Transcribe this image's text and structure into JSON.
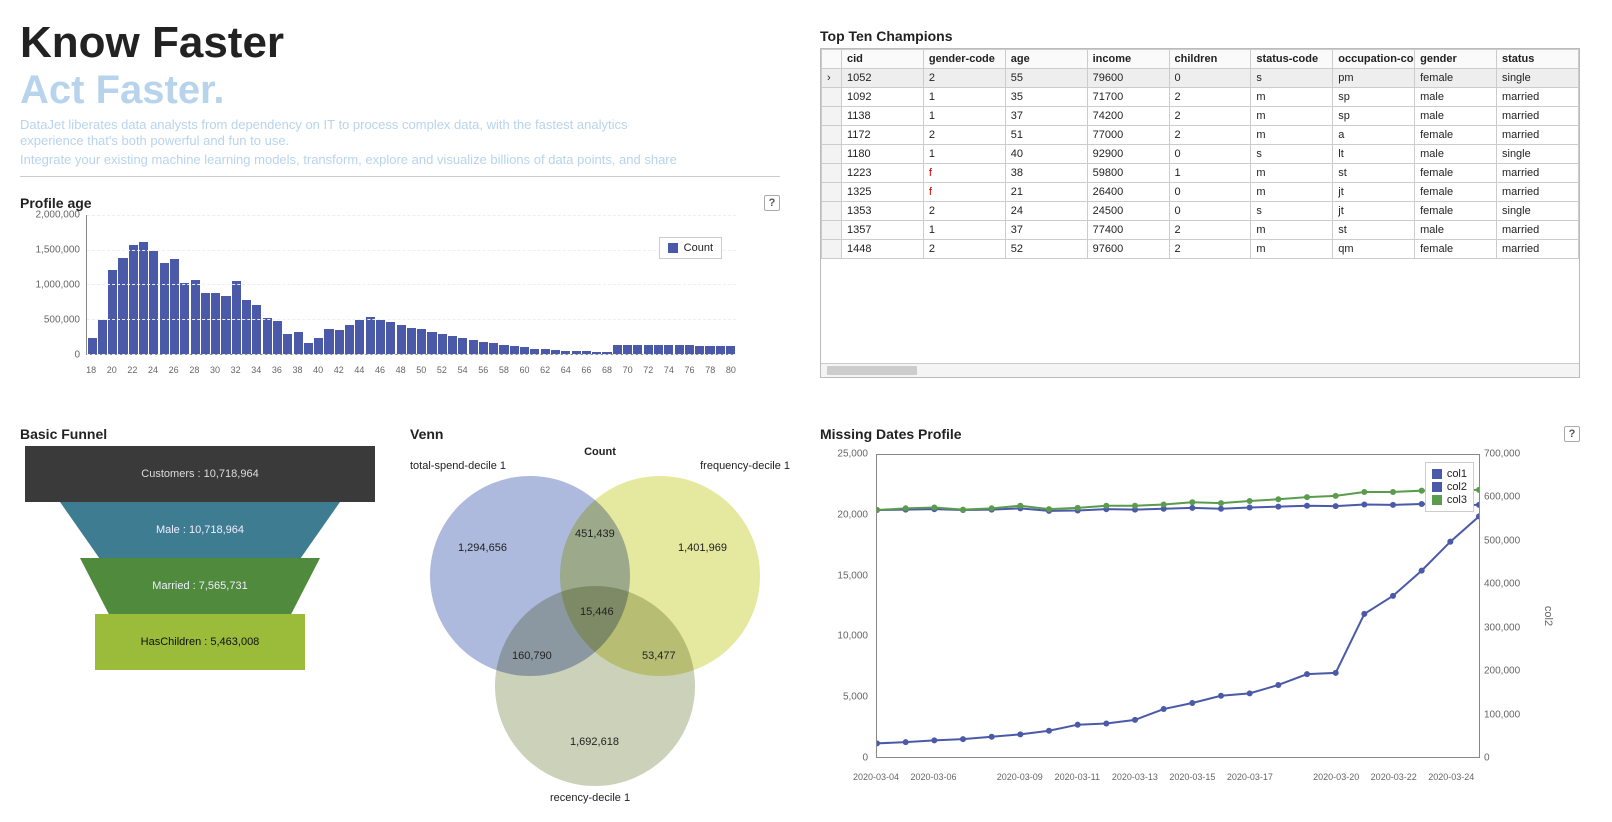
{
  "hero": {
    "title": "Know Faster",
    "subtitle": "Act Faster.",
    "p1": "DataJet liberates data analysts from dependency on IT to process complex data, with the fastest analytics experience that's both powerful and fun to use.",
    "p2": "Integrate your existing machine learning models, transform, explore and visualize billions of data points, and share"
  },
  "profile_age": {
    "title": "Profile age",
    "legend": "Count",
    "help": "?"
  },
  "funnel": {
    "title": "Basic Funnel",
    "stages": [
      "Customers : 10,718,964",
      "Male : 10,718,964",
      "Married : 7,565,731",
      "HasChildren : 5,463,008"
    ]
  },
  "venn": {
    "title": "Venn",
    "center_title": "Count",
    "labels": {
      "a": "total-spend-decile 1",
      "b": "frequency-decile 1",
      "c": "recency-decile 1",
      "only_a": "1,294,656",
      "only_b": "1,401,969",
      "only_c": "1,692,618",
      "ab": "451,439",
      "ac": "160,790",
      "bc": "53,477",
      "abc": "15,446"
    }
  },
  "table": {
    "title": "Top Ten Champions",
    "headers": [
      "cid",
      "gender-code",
      "age",
      "income",
      "children",
      "status-code",
      "occupation-cod",
      "gender",
      "status"
    ],
    "rows": [
      [
        "1052",
        "2",
        "55",
        "79600",
        "0",
        "s",
        "pm",
        "female",
        "single"
      ],
      [
        "1092",
        "1",
        "35",
        "71700",
        "2",
        "m",
        "sp",
        "male",
        "married"
      ],
      [
        "1138",
        "1",
        "37",
        "74200",
        "2",
        "m",
        "sp",
        "male",
        "married"
      ],
      [
        "1172",
        "2",
        "51",
        "77000",
        "2",
        "m",
        "a",
        "female",
        "married"
      ],
      [
        "1180",
        "1",
        "40",
        "92900",
        "0",
        "s",
        "lt",
        "male",
        "single"
      ],
      [
        "1223",
        "f",
        "38",
        "59800",
        "1",
        "m",
        "st",
        "female",
        "married"
      ],
      [
        "1325",
        "f",
        "21",
        "26400",
        "0",
        "m",
        "jt",
        "female",
        "married"
      ],
      [
        "1353",
        "2",
        "24",
        "24500",
        "0",
        "s",
        "jt",
        "female",
        "single"
      ],
      [
        "1357",
        "1",
        "37",
        "77400",
        "2",
        "m",
        "st",
        "male",
        "married"
      ],
      [
        "1448",
        "2",
        "52",
        "97600",
        "2",
        "m",
        "qm",
        "female",
        "married"
      ]
    ]
  },
  "missing": {
    "title": "Missing Dates Profile",
    "help": "?",
    "legend": [
      "col1",
      "col2",
      "col3"
    ],
    "axis_r_title": "col2"
  },
  "chart_data": [
    {
      "id": "profile_age",
      "type": "bar",
      "title": "Profile age",
      "ylabel": "",
      "ylim": [
        0,
        2000000
      ],
      "yticks": [
        0,
        500000,
        1000000,
        1500000,
        2000000
      ],
      "ytick_labels": [
        "0",
        "500,000",
        "1,000,000",
        "1,500,000",
        "2,000,000"
      ],
      "xticks": [
        18,
        20,
        22,
        24,
        26,
        28,
        30,
        32,
        34,
        36,
        38,
        40,
        42,
        44,
        46,
        48,
        50,
        52,
        54,
        56,
        58,
        60,
        62,
        64,
        66,
        68,
        70,
        72,
        74,
        76,
        78,
        80
      ],
      "series": [
        {
          "name": "Count",
          "x": [
            18,
            19,
            20,
            21,
            22,
            23,
            24,
            25,
            26,
            27,
            28,
            29,
            30,
            31,
            32,
            33,
            34,
            35,
            36,
            37,
            38,
            39,
            40,
            41,
            42,
            43,
            44,
            45,
            46,
            47,
            48,
            49,
            50,
            51,
            52,
            53,
            54,
            55,
            56,
            57,
            58,
            59,
            60,
            61,
            62,
            63,
            64,
            65,
            66,
            67,
            68,
            69,
            70,
            71,
            72,
            73,
            74,
            75,
            76,
            77,
            78,
            79,
            80
          ],
          "values": [
            230000,
            480000,
            1200000,
            1380000,
            1570000,
            1610000,
            1480000,
            1310000,
            1370000,
            1020000,
            1060000,
            870000,
            880000,
            830000,
            1050000,
            770000,
            700000,
            510000,
            470000,
            290000,
            310000,
            160000,
            230000,
            360000,
            340000,
            410000,
            480000,
            530000,
            480000,
            450000,
            410000,
            370000,
            350000,
            320000,
            280000,
            250000,
            220000,
            200000,
            170000,
            150000,
            130000,
            110000,
            95000,
            75000,
            65000,
            55000,
            45000,
            40000,
            35000,
            32000,
            30000,
            130000,
            130000,
            130000,
            130000,
            128000,
            125000,
            122000,
            120000,
            118000,
            116000,
            114000,
            112000
          ]
        }
      ]
    },
    {
      "id": "basic_funnel",
      "type": "funnel",
      "title": "Basic Funnel",
      "categories": [
        "Customers",
        "Male",
        "Married",
        "HasChildren"
      ],
      "values": [
        10718964,
        10718964,
        7565731,
        5463008
      ]
    },
    {
      "id": "venn",
      "type": "venn",
      "title": "Count",
      "sets": {
        "total-spend-decile 1": 1294656,
        "frequency-decile 1": 1401969,
        "recency-decile 1": 1692618,
        "total-spend-decile 1 & frequency-decile 1": 451439,
        "total-spend-decile 1 & recency-decile 1": 160790,
        "frequency-decile 1 & recency-decile 1": 53477,
        "all": 15446
      }
    },
    {
      "id": "missing_dates",
      "type": "line",
      "title": "Missing Dates Profile",
      "x": [
        "2020-03-04",
        "2020-03-05",
        "2020-03-06",
        "2020-03-07",
        "2020-03-08",
        "2020-03-09",
        "2020-03-10",
        "2020-03-11",
        "2020-03-12",
        "2020-03-13",
        "2020-03-14",
        "2020-03-15",
        "2020-03-16",
        "2020-03-17",
        "2020-03-18",
        "2020-03-19",
        "2020-03-20",
        "2020-03-21",
        "2020-03-22",
        "2020-03-23",
        "2020-03-24",
        "2020-03-25"
      ],
      "xticks": [
        "2020-03-04",
        "2020-03-06",
        "2020-03-09",
        "2020-03-11",
        "2020-03-13",
        "2020-03-15",
        "2020-03-17",
        "2020-03-20",
        "2020-03-22",
        "2020-03-24"
      ],
      "y_left": {
        "lim": [
          0,
          25000
        ],
        "ticks": [
          0,
          5000,
          10000,
          15000,
          20000,
          25000
        ],
        "tick_labels": [
          "0",
          "5,000",
          "10,000",
          "15,000",
          "20,000",
          "25,000"
        ]
      },
      "y_right": {
        "lim": [
          0,
          700000
        ],
        "ticks": [
          0,
          100000,
          200000,
          300000,
          400000,
          500000,
          600000,
          700000
        ],
        "tick_labels": [
          "0",
          "100,000",
          "200,000",
          "300,000",
          "400,000",
          "500,000",
          "600,000",
          "700,000"
        ]
      },
      "series": [
        {
          "name": "col1",
          "axis": "left",
          "color": "#4a5aa8",
          "values": [
            1050,
            1150,
            1300,
            1400,
            1600,
            1800,
            2100,
            2600,
            2700,
            3000,
            3900,
            4400,
            5000,
            5200,
            5900,
            6800,
            6900,
            11800,
            13300,
            15400,
            17800,
            19900
          ]
        },
        {
          "name": "col2",
          "axis": "right",
          "color": "#4a5aa8",
          "values": [
            572000,
            573000,
            574000,
            572000,
            573000,
            576000,
            570000,
            571000,
            574000,
            573000,
            575000,
            577000,
            575000,
            578000,
            580000,
            582000,
            581000,
            585000,
            584000,
            586000,
            584000,
            584000
          ]
        },
        {
          "name": "col3",
          "axis": "right",
          "color": "#5a9b4e",
          "values": [
            572000,
            576000,
            578000,
            573000,
            576000,
            582000,
            574000,
            577000,
            582000,
            582000,
            585000,
            590000,
            588000,
            593000,
            597000,
            602000,
            605000,
            614000,
            614000,
            617000,
            618000,
            619000
          ]
        }
      ]
    }
  ]
}
